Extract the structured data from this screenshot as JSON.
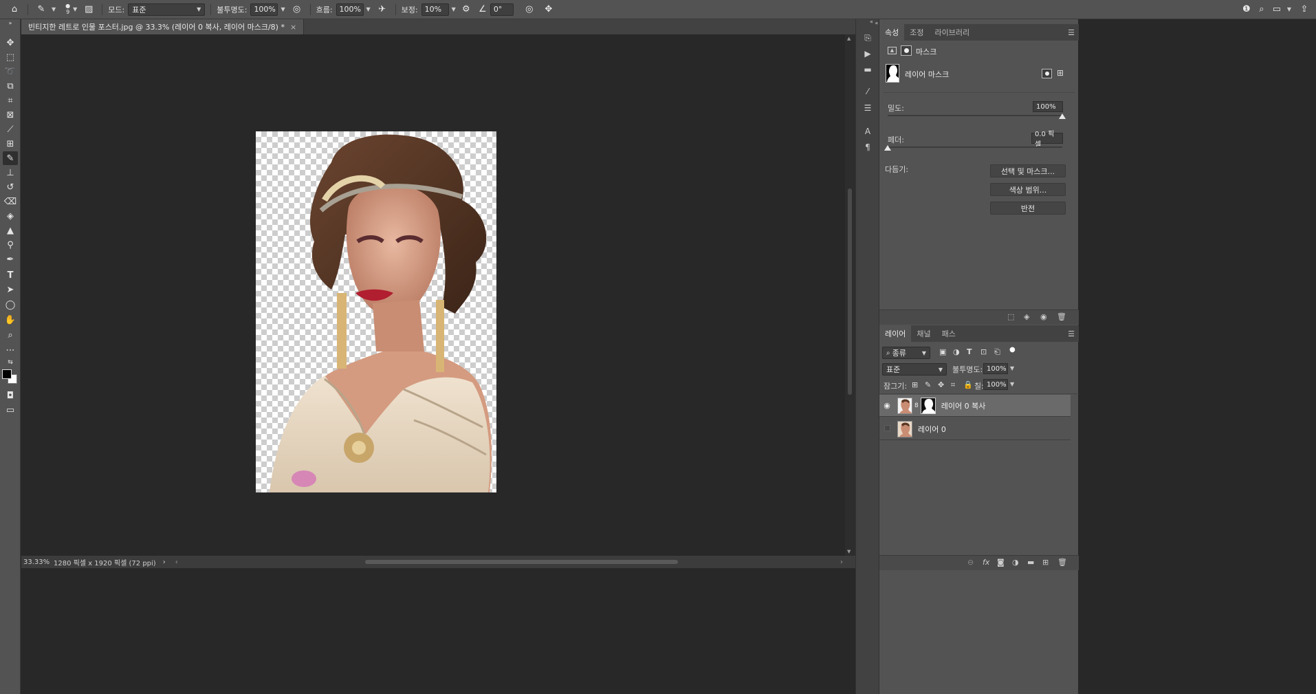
{
  "options_bar": {
    "mode_label": "모드:",
    "mode_value": "표준",
    "opacity_label": "불투명도:",
    "opacity_value": "100%",
    "flow_label": "흐름:",
    "flow_value": "100%",
    "smoothing_label": "보정:",
    "smoothing_value": "10%",
    "angle_value": "0°",
    "brush_size": "9"
  },
  "document": {
    "tab_title": "빈티지한 레트로 인물 포스터.jpg @ 33.3% (레이어 0 복사, 레이어 마스크/8) *",
    "close_glyph": "×"
  },
  "status": {
    "zoom": "33.33%",
    "dimensions": "1280 픽셀 x 1920 픽셀 (72 ppi)"
  },
  "properties": {
    "tabs": [
      "속성",
      "조정",
      "라이브러리"
    ],
    "mask_kind_label": "마스크",
    "layer_mask_label": "레이어 마스크",
    "density_label": "밀도:",
    "density_value": "100%",
    "feather_label": "페더:",
    "feather_value": "0.0 픽셀",
    "refine_label": "다듬기:",
    "buttons": [
      "선택 및 마스크...",
      "색상 범위...",
      "반전"
    ]
  },
  "layers_panel": {
    "tabs": [
      "레이어",
      "채널",
      "패스"
    ],
    "filter_label": "종류",
    "blend_mode": "표준",
    "opacity_label": "불투명도:",
    "opacity_value": "100%",
    "lock_label": "잠그기:",
    "fill_label": "칠:",
    "fill_value": "100%",
    "layers": [
      {
        "name": "레이어 0 복사",
        "visible": true,
        "selected": true,
        "has_mask": true
      },
      {
        "name": "레이어 0",
        "visible": false,
        "selected": false,
        "has_mask": false
      }
    ]
  },
  "colors": {
    "ui_panel": "#535353",
    "ui_dark": "#282828",
    "foreground": "#000000",
    "background": "#ffffff"
  }
}
